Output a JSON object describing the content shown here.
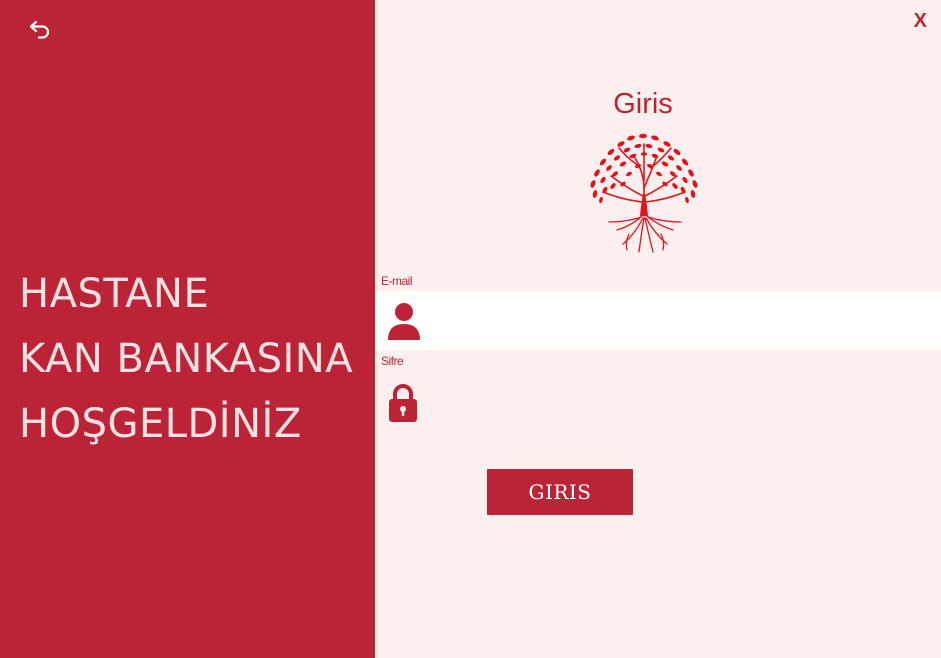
{
  "window": {
    "close_label": "X",
    "back_icon": "undo-arrow-icon"
  },
  "welcome": {
    "line1": "HASTANE",
    "line2": "KAN BANKASINA",
    "line3": "HOŞGELDİNİZ"
  },
  "login": {
    "title": "Giris",
    "logo_icon": "tree-icon",
    "email_label": "E-mail",
    "email_value": "",
    "email_icon": "user-icon",
    "password_label": "Sifre",
    "password_value": "",
    "password_icon": "lock-icon",
    "submit_label": "GIRIS"
  },
  "colors": {
    "primary": "#bb2437",
    "panel_background": "#fcf0ef",
    "welcome_text": "#f6e2e0",
    "input_background": "#ffffff",
    "logo_red": "#e0141e"
  }
}
